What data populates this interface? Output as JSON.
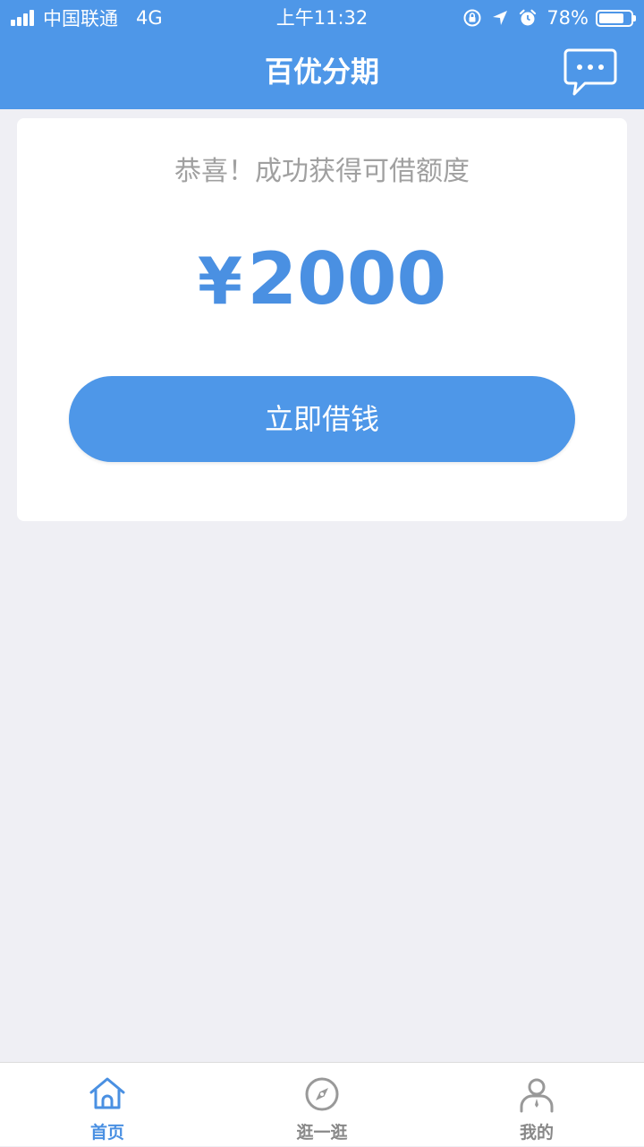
{
  "status_bar": {
    "carrier": "中国联通",
    "network": "4G",
    "time": "上午11:32",
    "battery": "78%",
    "battery_level": 0.78
  },
  "header": {
    "title": "百优分期",
    "message_icon": "chat-bubble-icon"
  },
  "card": {
    "congrats_text": "恭喜！成功获得可借额度",
    "currency_symbol": "¥",
    "amount": "2000",
    "borrow_button": "立即借钱"
  },
  "tabbar": {
    "tabs": [
      {
        "label": "首页",
        "icon": "home-icon",
        "active": true
      },
      {
        "label": "逛一逛",
        "icon": "compass-icon",
        "active": false
      },
      {
        "label": "我的",
        "icon": "user-icon",
        "active": false
      }
    ]
  },
  "colors": {
    "accent": "#4e97e8",
    "amount": "#4a90e2",
    "background": "#efeff4",
    "muted_text": "#a0a0a0",
    "tab_inactive": "#888888"
  }
}
